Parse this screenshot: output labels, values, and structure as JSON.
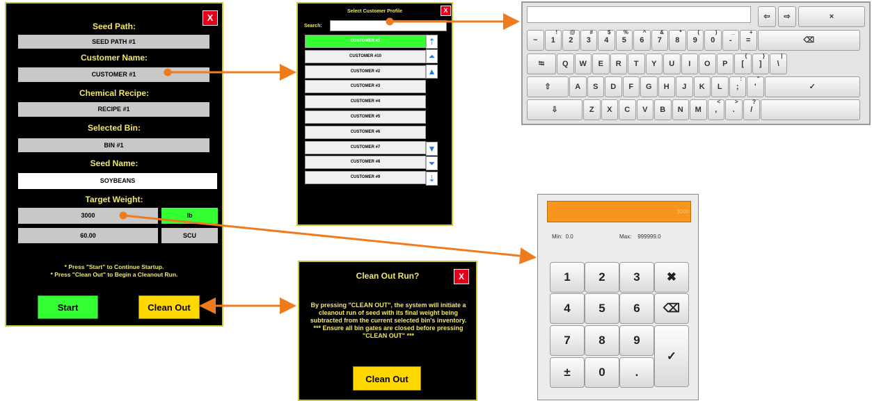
{
  "main": {
    "close": "X",
    "seed_path_label": "Seed Path:",
    "seed_path_value": "SEED PATH #1",
    "customer_label": "Customer Name:",
    "customer_value": "CUSTOMER #1",
    "recipe_label": "Chemical Recipe:",
    "recipe_value": "RECIPE #1",
    "bin_label": "Selected Bin:",
    "bin_value": "BIN #1",
    "seed_name_label": "Seed Name:",
    "seed_name_value": "SOYBEANS",
    "target_weight_label": "Target Weight:",
    "weight_value": "3000",
    "weight_unit": "lb",
    "scu_value": "60.00",
    "scu_unit": "SCU",
    "note1": "* Press \"Start\" to Continue Startup.",
    "note2": "* Press \"Clean Out\" to Begin a Cleanout Run.",
    "start": "Start",
    "clean_out": "Clean Out"
  },
  "customer_dialog": {
    "title": "Select Customer Profile",
    "close": "X",
    "search_label": "Search:",
    "search_value": "",
    "items": [
      "CUSTOMER #1",
      "CUSTOMER #10",
      "CUSTOMER #2",
      "CUSTOMER #3",
      "CUSTOMER #4",
      "CUSTOMER #5",
      "CUSTOMER #6",
      "CUSTOMER #7",
      "CUSTOMER #8",
      "CUSTOMER #9"
    ],
    "selected_index": 0
  },
  "keyboard": {
    "input_value": "",
    "top_keys": [
      "⇦",
      "⇨",
      "×"
    ],
    "row1": [
      [
        "~",
        ""
      ],
      [
        "1",
        "!"
      ],
      [
        "2",
        "@"
      ],
      [
        "3",
        "#"
      ],
      [
        "4",
        "$"
      ],
      [
        "5",
        "%"
      ],
      [
        "6",
        "^"
      ],
      [
        "7",
        "&"
      ],
      [
        "8",
        "*"
      ],
      [
        "9",
        "("
      ],
      [
        "0",
        ")"
      ],
      [
        "-",
        "_"
      ],
      [
        "=",
        "+"
      ]
    ],
    "backspace": "⌫",
    "tab": "⭾",
    "row2": [
      [
        "Q",
        ""
      ],
      [
        "W",
        ""
      ],
      [
        "E",
        ""
      ],
      [
        "R",
        ""
      ],
      [
        "T",
        ""
      ],
      [
        "Y",
        ""
      ],
      [
        "U",
        ""
      ],
      [
        "I",
        ""
      ],
      [
        "O",
        ""
      ],
      [
        "P",
        ""
      ],
      [
        "[",
        "{"
      ],
      [
        "]",
        "}"
      ],
      [
        "\\",
        "|"
      ]
    ],
    "shift": "⇧",
    "row3": [
      [
        "A",
        ""
      ],
      [
        "S",
        ""
      ],
      [
        "D",
        ""
      ],
      [
        "F",
        ""
      ],
      [
        "G",
        ""
      ],
      [
        "H",
        ""
      ],
      [
        "J",
        ""
      ],
      [
        "K",
        ""
      ],
      [
        "L",
        ""
      ],
      [
        ";",
        ":"
      ],
      [
        "'",
        "\""
      ]
    ],
    "enter": "✓",
    "down": "⇩",
    "row4": [
      [
        "Z",
        ""
      ],
      [
        "X",
        ""
      ],
      [
        "C",
        ""
      ],
      [
        "V",
        ""
      ],
      [
        "B",
        ""
      ],
      [
        "N",
        ""
      ],
      [
        "M",
        ""
      ],
      [
        ",",
        "<"
      ],
      [
        ".",
        ">"
      ],
      [
        "/",
        "?"
      ]
    ]
  },
  "numpad": {
    "display_value": "3000",
    "min_label": "Min:",
    "min_value": "0.0",
    "max_label": "Max:",
    "max_value": "999999.0",
    "keys": [
      "1",
      "2",
      "3",
      "✖",
      "4",
      "5",
      "6",
      "⌫",
      "7",
      "8",
      "9",
      "✓",
      "±",
      "0",
      "."
    ]
  },
  "cleanout_dialog": {
    "title": "Clean Out Run?",
    "close": "X",
    "message": "By pressing \"CLEAN OUT\", the system will initiate a cleanout run of seed with its final weight being subtracted from the current selected bin's inventory.\n*** Ensure all bin gates are closed before pressing \"CLEAN OUT\" ***",
    "button": "Clean Out"
  },
  "colors": {
    "panel_bg": "#000000",
    "label_yellow": "#f2e76c",
    "accent_green": "#33ff33",
    "accent_yellow": "#ffd800",
    "close_red": "#e4001b",
    "arrow_orange": "#f07b1c",
    "list_blue": "#1f75d6"
  }
}
